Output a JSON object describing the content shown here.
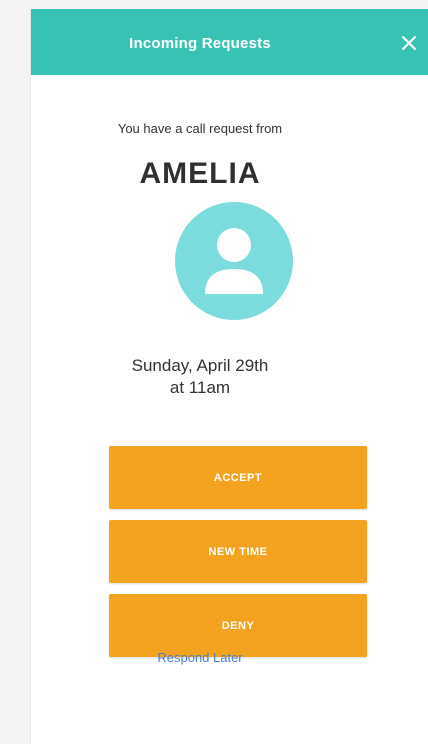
{
  "header": {
    "title": "Incoming Requests",
    "close_icon": "close-icon",
    "background_color": "#38c2b3"
  },
  "request": {
    "prompt": "You have a call request from",
    "caller_name": "AMELIA",
    "avatar_icon": "person-icon",
    "avatar_color": "#7cdbdc",
    "date_line1": "Sunday, April 29th",
    "date_line2": "at 11am"
  },
  "actions": {
    "accept_label": "ACCEPT",
    "new_time_label": "NEW TIME",
    "deny_label": "DENY",
    "respond_later_label": "Respond Later",
    "button_color": "#f3a31f"
  }
}
